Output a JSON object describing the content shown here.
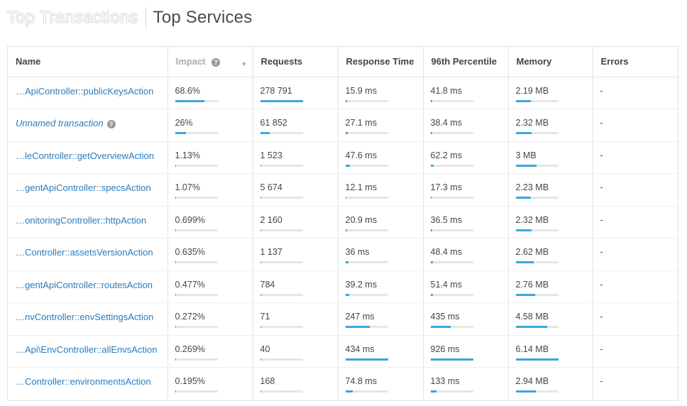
{
  "tabs": [
    {
      "label": "Top Transactions",
      "active": true
    },
    {
      "label": "Top Services",
      "active": false
    }
  ],
  "columns": {
    "name": "Name",
    "impact": "Impact",
    "requests": "Requests",
    "response_time": "Response Time",
    "percentile": "96th Percentile",
    "memory": "Memory",
    "errors": "Errors"
  },
  "icons": {
    "help": "question-circle-icon",
    "sort": "sort-desc-icon"
  },
  "accent_color": "#3aa8d8",
  "rows": [
    {
      "name": "…ApiController::publicKeysAction",
      "italic": false,
      "help": false,
      "impact": "68.6%",
      "impact_pct": 68.6,
      "requests": "278 791",
      "requests_pct": 100,
      "response": "15.9 ms",
      "response_pct": 3.7,
      "p96": "41.8 ms",
      "p96_pct": 4.5,
      "memory": "2.19 MB",
      "memory_pct": 35.7,
      "errors": "-"
    },
    {
      "name": "Unnamed transaction",
      "italic": true,
      "help": true,
      "impact": "26%",
      "impact_pct": 26,
      "requests": "61 852",
      "requests_pct": 22.2,
      "response": "27.1 ms",
      "response_pct": 6.2,
      "p96": "38.4 ms",
      "p96_pct": 4.1,
      "memory": "2.32 MB",
      "memory_pct": 37.8,
      "errors": "-"
    },
    {
      "name": "…leController::getOverviewAction",
      "italic": false,
      "help": false,
      "impact": "1.13%",
      "impact_pct": 1.13,
      "requests": "1 523",
      "requests_pct": 0.5,
      "response": "47.6 ms",
      "response_pct": 11,
      "p96": "62.2 ms",
      "p96_pct": 6.7,
      "memory": "3 MB",
      "memory_pct": 48.9,
      "errors": "-"
    },
    {
      "name": "…gentApiController::specsAction",
      "italic": false,
      "help": false,
      "impact": "1.07%",
      "impact_pct": 1.07,
      "requests": "5 674",
      "requests_pct": 2,
      "response": "12.1 ms",
      "response_pct": 2.8,
      "p96": "17.3 ms",
      "p96_pct": 1.9,
      "memory": "2.23 MB",
      "memory_pct": 36.3,
      "errors": "-"
    },
    {
      "name": "…onitoringController::httpAction",
      "italic": false,
      "help": false,
      "impact": "0.699%",
      "impact_pct": 0.7,
      "requests": "2 160",
      "requests_pct": 0.8,
      "response": "20.9 ms",
      "response_pct": 4.8,
      "p96": "36.5 ms",
      "p96_pct": 3.9,
      "memory": "2.32 MB",
      "memory_pct": 37.8,
      "errors": "-"
    },
    {
      "name": "…Controller::assetsVersionAction",
      "italic": false,
      "help": false,
      "impact": "0.635%",
      "impact_pct": 0.64,
      "requests": "1 137",
      "requests_pct": 0.4,
      "response": "36 ms",
      "response_pct": 8.3,
      "p96": "48.4 ms",
      "p96_pct": 5.2,
      "memory": "2.62 MB",
      "memory_pct": 42.7,
      "errors": "-"
    },
    {
      "name": "…gentApiController::routesAction",
      "italic": false,
      "help": false,
      "impact": "0.477%",
      "impact_pct": 0.48,
      "requests": "784",
      "requests_pct": 0.3,
      "response": "39.2 ms",
      "response_pct": 9,
      "p96": "51.4 ms",
      "p96_pct": 5.6,
      "memory": "2.76 MB",
      "memory_pct": 45,
      "errors": "-"
    },
    {
      "name": "…nvController::envSettingsAction",
      "italic": false,
      "help": false,
      "impact": "0.272%",
      "impact_pct": 0.27,
      "requests": "71",
      "requests_pct": 0.03,
      "response": "247 ms",
      "response_pct": 56.9,
      "p96": "435 ms",
      "p96_pct": 47,
      "memory": "4.58 MB",
      "memory_pct": 74.6,
      "errors": "-"
    },
    {
      "name": "…Api\\EnvController::allEnvsAction",
      "italic": false,
      "help": false,
      "impact": "0.269%",
      "impact_pct": 0.27,
      "requests": "40",
      "requests_pct": 0.01,
      "response": "434 ms",
      "response_pct": 100,
      "p96": "926 ms",
      "p96_pct": 100,
      "memory": "6.14 MB",
      "memory_pct": 100,
      "errors": "-"
    },
    {
      "name": "…Controller::environmentsAction",
      "italic": false,
      "help": false,
      "impact": "0.195%",
      "impact_pct": 0.2,
      "requests": "168",
      "requests_pct": 0.06,
      "response": "74.8 ms",
      "response_pct": 17.2,
      "p96": "133 ms",
      "p96_pct": 14.4,
      "memory": "2.94 MB",
      "memory_pct": 47.9,
      "errors": "-"
    }
  ]
}
